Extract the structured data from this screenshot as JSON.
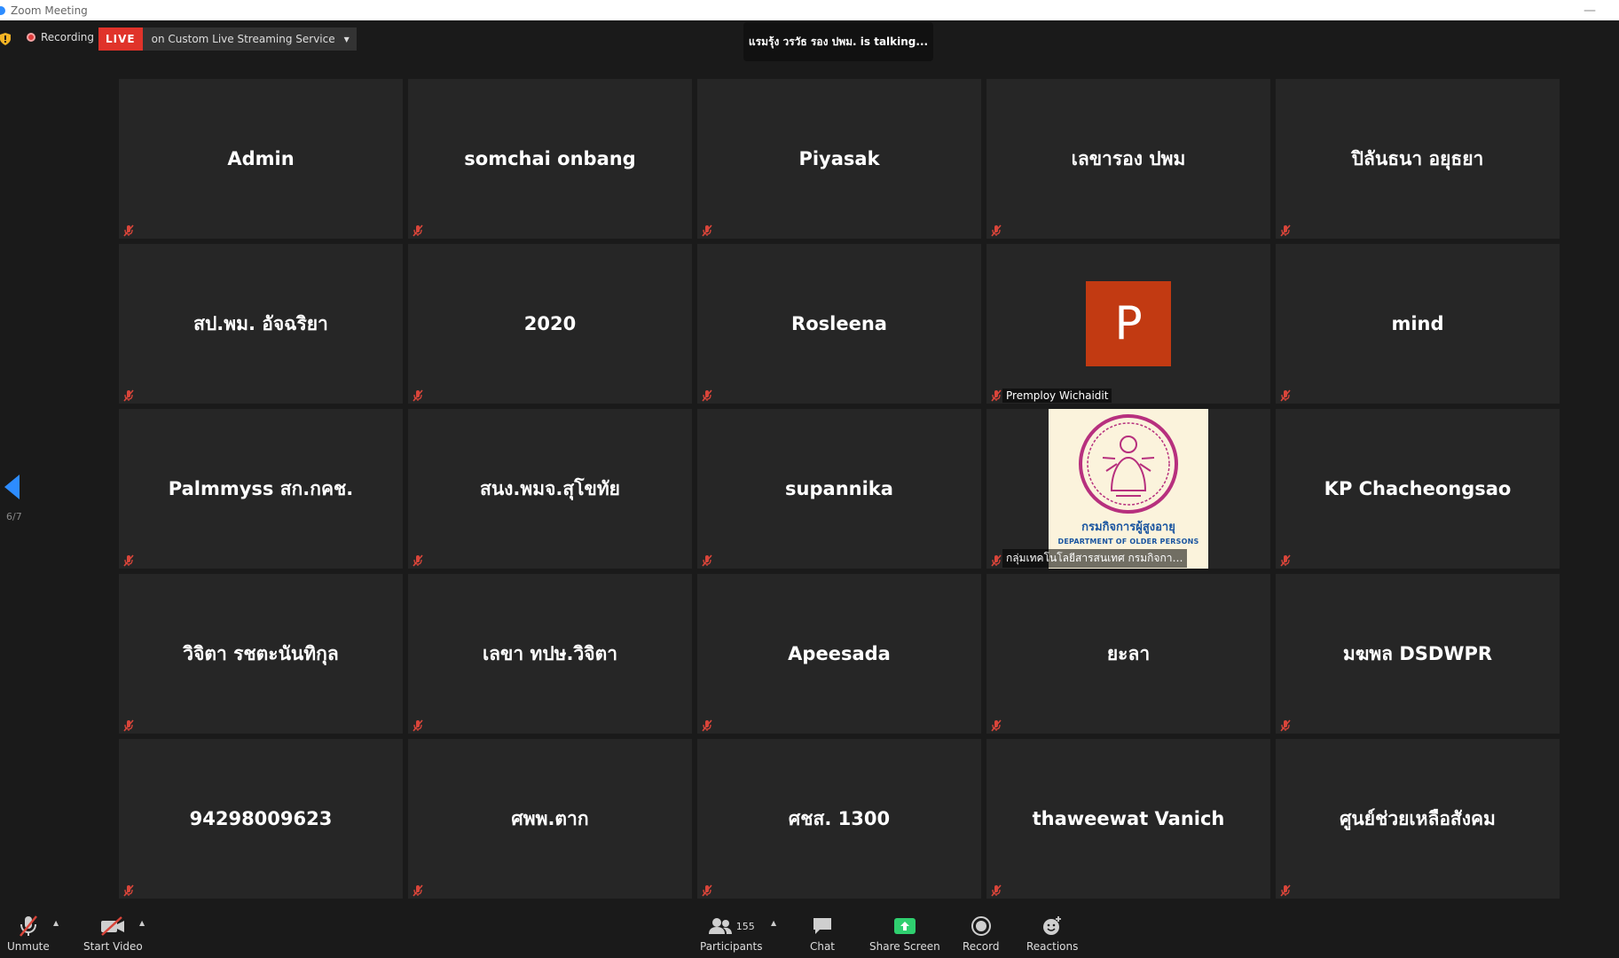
{
  "window": {
    "title": "Zoom Meeting"
  },
  "topbar": {
    "recording_label": "Recording",
    "live_label": "LIVE",
    "live_service": "on Custom Live Streaming Service",
    "talking_text": "แรมรุ้ง วรวัธ รอง ปพม. is  talking..."
  },
  "pager": {
    "page": "6/7"
  },
  "tiles": [
    {
      "name": "Admin"
    },
    {
      "name": "somchai onbang"
    },
    {
      "name": "Piyasak"
    },
    {
      "name": "เลขารอง ปพม"
    },
    {
      "name": "ปิลันธนา อยุธยา"
    },
    {
      "name": "สป.พม. อัจฉริยา"
    },
    {
      "name": "2020"
    },
    {
      "name": "Rosleena"
    },
    {
      "name": "",
      "avatar_letter": "P",
      "label": "Premploy Wichaidit"
    },
    {
      "name": "mind"
    },
    {
      "name": "Palmmyss สก.กคช."
    },
    {
      "name": "สนง.พมจ.สุโขทัย"
    },
    {
      "name": "supannika"
    },
    {
      "name": "",
      "logo_th": "กรมกิจการผู้สูงอายุ",
      "logo_en": "DEPARTMENT OF OLDER PERSONS",
      "label": "กลุ่มเทคโนโลยีสารสนเทศ กรมกิจการผู้..."
    },
    {
      "name": "KP Chacheongsao"
    },
    {
      "name": "วิจิตา รชตะนันทิกุล"
    },
    {
      "name": "เลขา ทปษ.วิจิตา"
    },
    {
      "name": "Apeesada"
    },
    {
      "name": "ยะลา"
    },
    {
      "name": "มฆพล DSDWPR"
    },
    {
      "name": "94298009623"
    },
    {
      "name": "ศพพ.ตาก"
    },
    {
      "name": "ศชส. 1300"
    },
    {
      "name": "thaweewat Vanich"
    },
    {
      "name": "ศูนย์ช่วยเหลือสังคม"
    }
  ],
  "toolbar": {
    "unmute": "Unmute",
    "start_video": "Start Video",
    "participants": "Participants",
    "participants_count": "155",
    "chat": "Chat",
    "share_screen": "Share Screen",
    "record": "Record",
    "reactions": "Reactions"
  },
  "colors": {
    "accent": "#2d8cff",
    "live": "#e0332a",
    "share": "#2fcf6f",
    "mute": "#d9453a"
  }
}
